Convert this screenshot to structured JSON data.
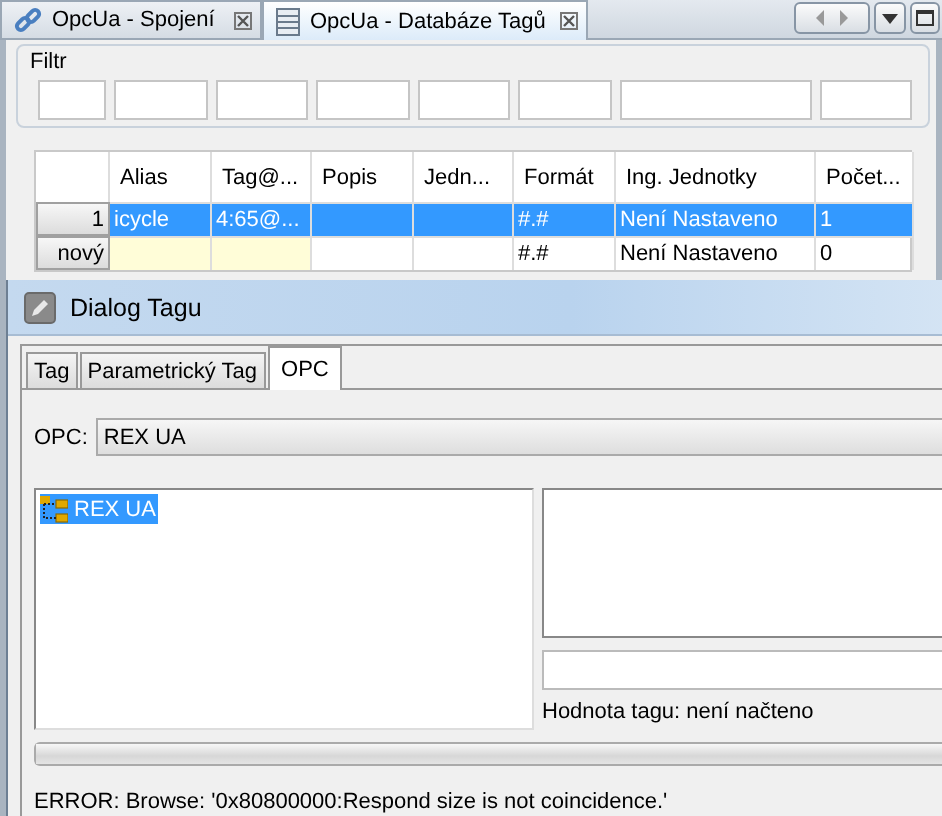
{
  "tabs": [
    {
      "label": "OpcUa - Spojení",
      "selected": false,
      "kind": "link"
    },
    {
      "label": "OpcUa - Databáze Tagů",
      "selected": true,
      "kind": "table"
    }
  ],
  "filter": {
    "label": "Filtr"
  },
  "table": {
    "columns": [
      "Alias",
      "Tag@...",
      "Popis",
      "Jedn...",
      "Formát",
      "Ing. Jednotky",
      "Počet..."
    ],
    "rows": [
      {
        "header": "1",
        "kind": "data",
        "selected": true,
        "cells": [
          "icycle",
          "4:65@...",
          null,
          null,
          "#.#",
          "Není Nastaveno",
          "1"
        ]
      },
      {
        "header": "nový",
        "kind": "new",
        "selected": false,
        "cells": [
          null,
          null,
          null,
          null,
          "#.#",
          "Není Nastaveno",
          "0"
        ]
      }
    ]
  },
  "dialog": {
    "title": "Dialog Tagu",
    "tabs": [
      {
        "label": "Tag",
        "selected": false
      },
      {
        "label": "Parametrický Tag",
        "selected": false
      },
      {
        "label": "OPC",
        "selected": true
      }
    ],
    "opc_label": "OPC:",
    "opc_value": "REX UA",
    "tree": [
      {
        "label": "REX UA",
        "selected": true
      }
    ],
    "value_label": "Hodnota tagu:",
    "value_text": "není načteno",
    "progress": {
      "level": 1
    },
    "status": "ERROR: Browse: '0x80800000:Respond size is not coincidence.'"
  }
}
